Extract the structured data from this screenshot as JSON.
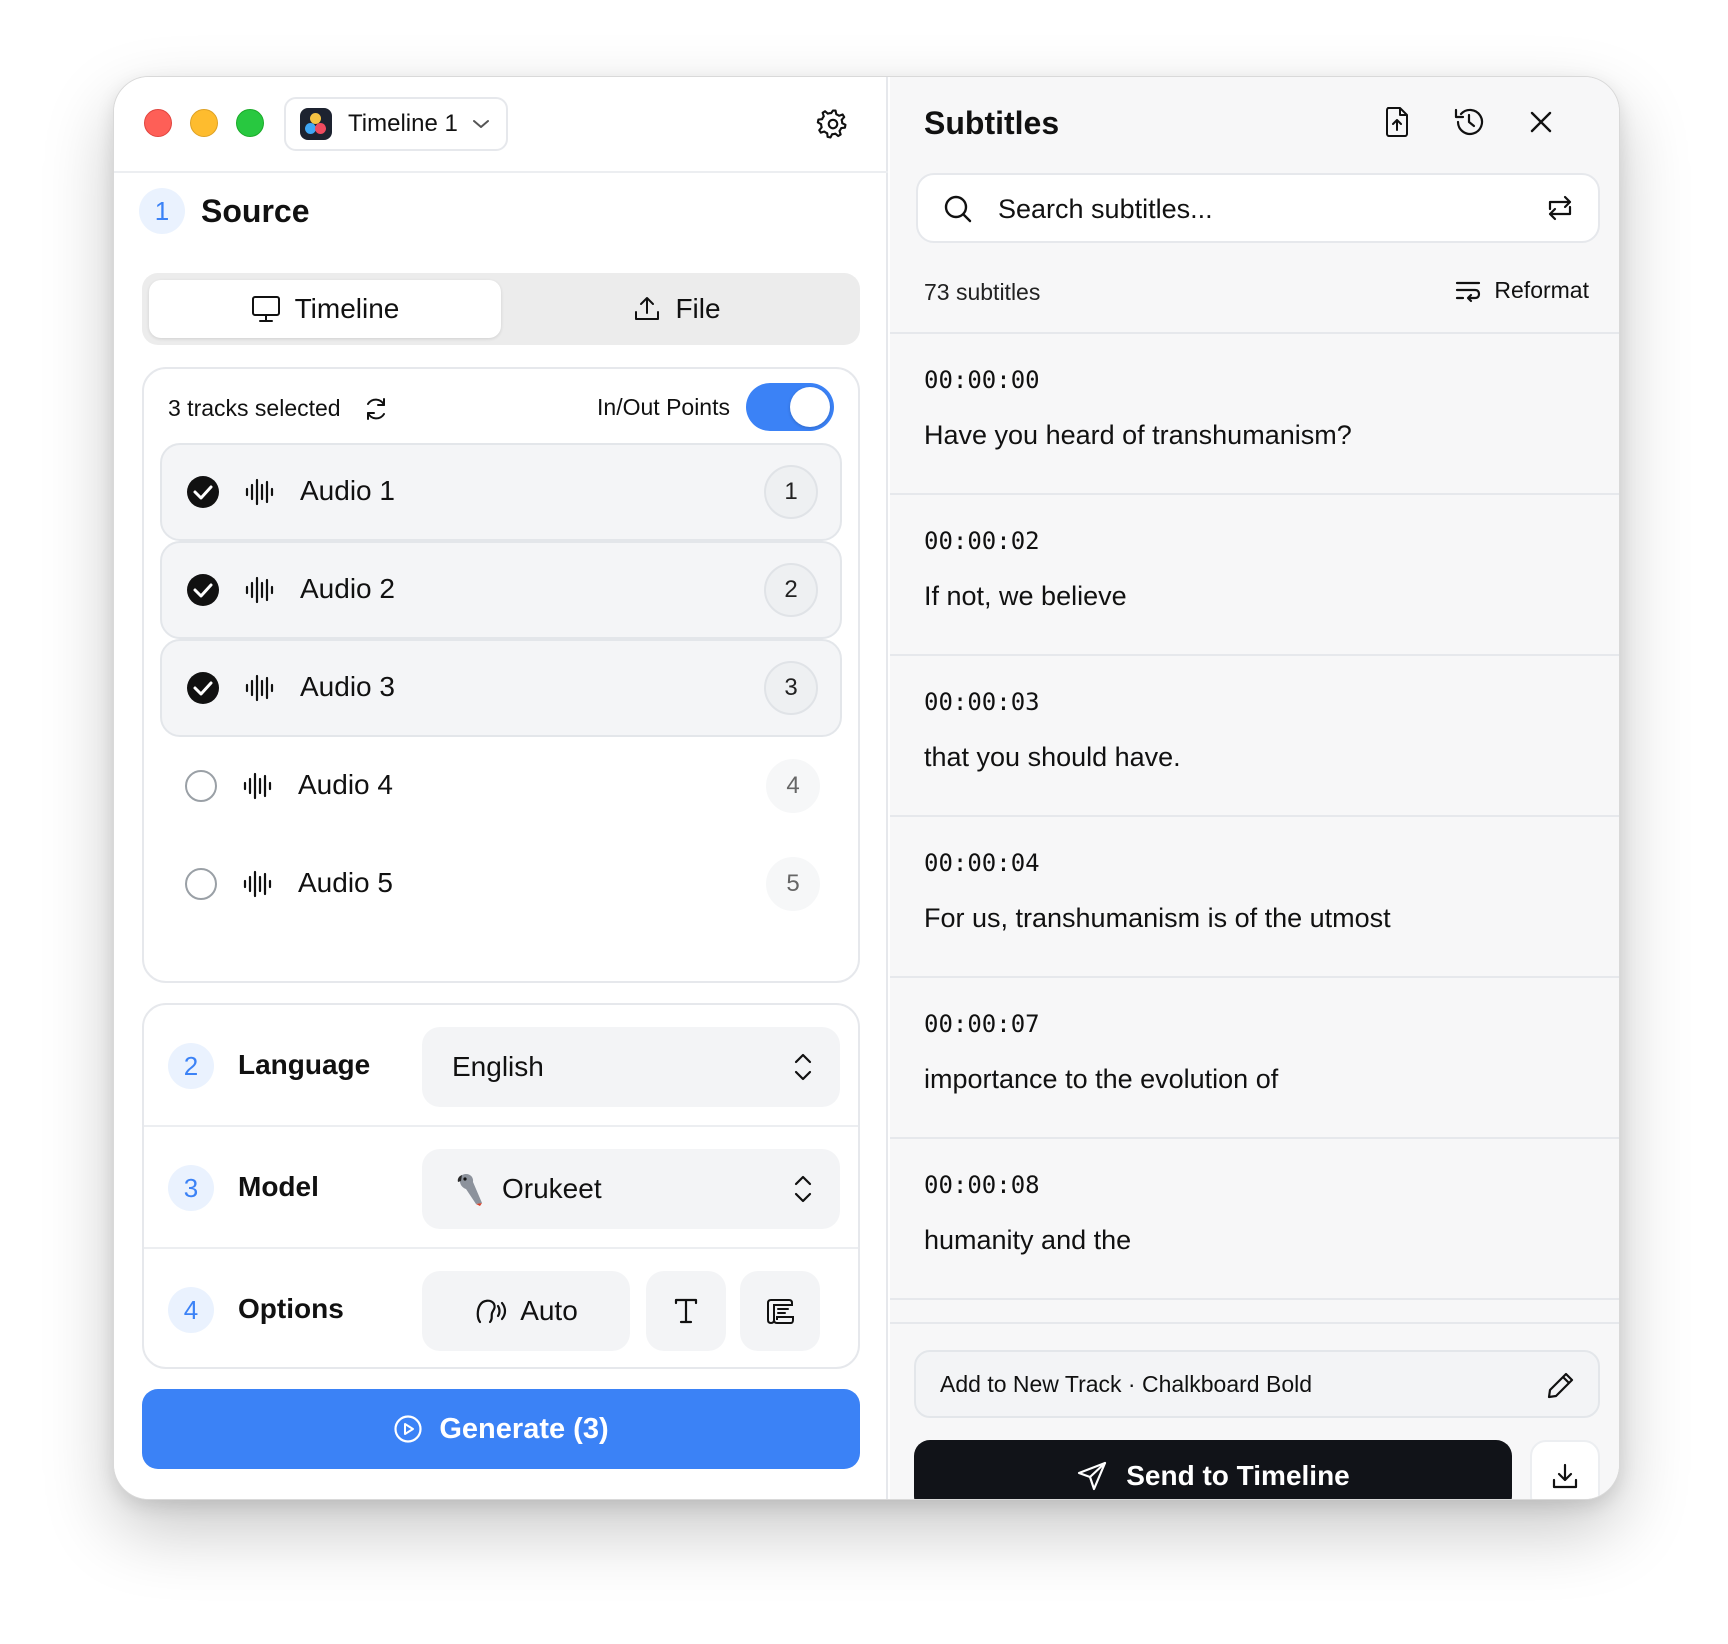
{
  "colors": {
    "accent": "#3b82f6",
    "dark_button": "#111318",
    "traffic_red": "#fe5f57",
    "traffic_yellow": "#febc2e",
    "traffic_green": "#28c840"
  },
  "titlebar": {
    "timeline_label": "Timeline 1",
    "icons": [
      "davinci-resolve-logo-icon",
      "chevron-down-icon",
      "gear-icon"
    ]
  },
  "source": {
    "step": "1",
    "title": "Source",
    "tabs": [
      {
        "label": "Timeline",
        "icon": "monitor-icon",
        "active": true
      },
      {
        "label": "File",
        "icon": "upload-icon",
        "active": false
      }
    ],
    "tracks_selected": "3 tracks selected",
    "inout_label": "In/Out Points",
    "inout_on": true,
    "tracks": [
      {
        "label": "Audio 1",
        "num": "1",
        "checked": true
      },
      {
        "label": "Audio 2",
        "num": "2",
        "checked": true
      },
      {
        "label": "Audio 3",
        "num": "3",
        "checked": true
      },
      {
        "label": "Audio 4",
        "num": "4",
        "checked": false
      },
      {
        "label": "Audio 5",
        "num": "5",
        "checked": false
      }
    ]
  },
  "language": {
    "step": "2",
    "title": "Language",
    "value": "English"
  },
  "model": {
    "step": "3",
    "title": "Model",
    "value": "Orukeet",
    "icon": "parrot-icon"
  },
  "options": {
    "step": "4",
    "title": "Options",
    "auto_label": "Auto",
    "icons": [
      "speaker-detect-icon",
      "text-icon",
      "script-icon"
    ]
  },
  "generate_label": "Generate (3)",
  "subtitles": {
    "title": "Subtitles",
    "header_icons": [
      "file-upload-icon",
      "history-icon",
      "close-icon"
    ],
    "search_placeholder": "Search subtitles...",
    "count": "73 subtitles",
    "reformat_label": "Reformat",
    "items": [
      {
        "time": "00:00:00",
        "text": "Have you heard of transhumanism?"
      },
      {
        "time": "00:00:02",
        "text": "If not, we believe"
      },
      {
        "time": "00:00:03",
        "text": "that you should have."
      },
      {
        "time": "00:00:04",
        "text": "For us, transhumanism is of the utmost"
      },
      {
        "time": "00:00:07",
        "text": "importance to the evolution of"
      },
      {
        "time": "00:00:08",
        "text": "humanity and the"
      }
    ],
    "track_style": "Add to New Track · Chalkboard Bold",
    "send_label": "Send to Timeline"
  }
}
